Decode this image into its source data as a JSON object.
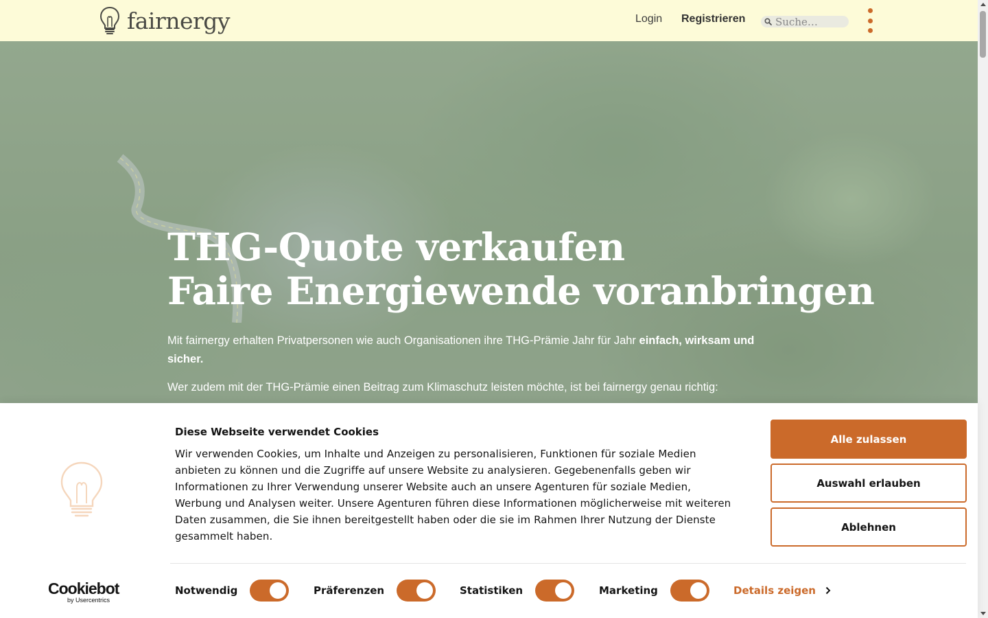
{
  "header": {
    "logo_text": "fairnergy",
    "login_label": "Login",
    "register_label": "Registrieren",
    "search_placeholder": "Suche…",
    "brand_color": "#cb6a2a"
  },
  "hero": {
    "title_line1": "THG-Quote verkaufen",
    "title_line2": "Faire Energiewende voranbringen",
    "paragraph1_text": "Mit fairnergy erhalten Privatpersonen wie auch Organisationen ihre THG-Prämie Jahr für Jahr ",
    "paragraph1_bold": "einfach, wirksam und sicher.",
    "paragraph2_text": "Wer zudem mit der THG-Prämie einen Beitrag zum Klimaschutz leisten möchte, ist bei fairnergy genau richtig:"
  },
  "cookie_banner": {
    "title": "Diese Webseite verwendet Cookies",
    "body": "Wir verwenden Cookies, um Inhalte und Anzeigen zu personalisieren, Funktionen für soziale Medien anbieten zu können und die Zugriffe auf unsere Website zu analysieren. Gegebenenfalls geben wir Informationen zu Ihrer Verwendung unserer Website auch an unsere Agenturen für soziale Medien, Werbung und Analysen weiter. Unsere Agenturen führen diese Informationen möglicherweise mit weiteren Daten zusammen, die Sie ihnen bereitgestellt haben oder die sie im Rahmen Ihrer Nutzung der Dienste gesammelt haben.",
    "allow_all_label": "Alle zulassen",
    "allow_selection_label": "Auswahl erlauben",
    "deny_label": "Ablehnen",
    "toggles": [
      {
        "label": "Notwendig",
        "on": true
      },
      {
        "label": "Präferenzen",
        "on": true
      },
      {
        "label": "Statistiken",
        "on": true
      },
      {
        "label": "Marketing",
        "on": true
      }
    ],
    "details_label": "Details zeigen",
    "provider_logo": "Cookiebot",
    "provider_sub": "by Usercentrics"
  }
}
